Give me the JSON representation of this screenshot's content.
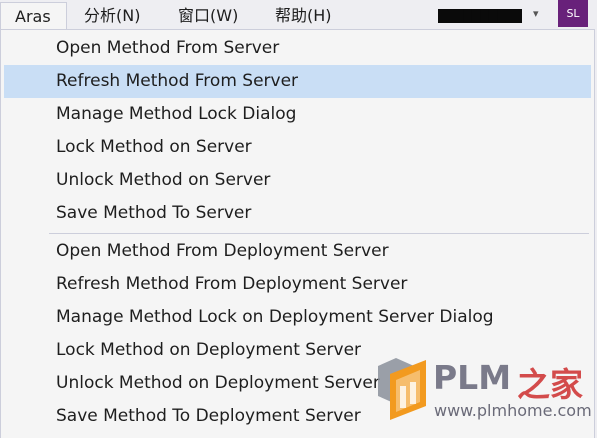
{
  "menubar": {
    "items": [
      {
        "label": "Aras"
      },
      {
        "label": "分析(N)"
      },
      {
        "label": "窗口(W)"
      },
      {
        "label": "帮助(H)"
      }
    ],
    "user_name": "████████",
    "dropdown_glyph": "▾",
    "avatar_initials": "SL",
    "avatar_color": "#68217a"
  },
  "menu": {
    "highlight_color": "#c9def5",
    "group1": [
      {
        "label": "Open Method From Server"
      },
      {
        "label": "Refresh Method From Server",
        "highlighted": true
      },
      {
        "label": "Manage Method Lock Dialog"
      },
      {
        "label": "Lock Method on Server"
      },
      {
        "label": "Unlock Method on Server"
      },
      {
        "label": "Save Method To Server"
      }
    ],
    "group2": [
      {
        "label": "Open Method From Deployment Server"
      },
      {
        "label": "Refresh Method From Deployment Server"
      },
      {
        "label": "Manage Method Lock on Deployment Server Dialog"
      },
      {
        "label": "Lock Method on Deployment Server"
      },
      {
        "label": "Unlock Method on Deployment Server"
      },
      {
        "label": "Save Method To Deployment Server"
      }
    ]
  },
  "watermark": {
    "brand": "PLM",
    "brand_cn": "之家",
    "url": "www.plmhome.com"
  }
}
